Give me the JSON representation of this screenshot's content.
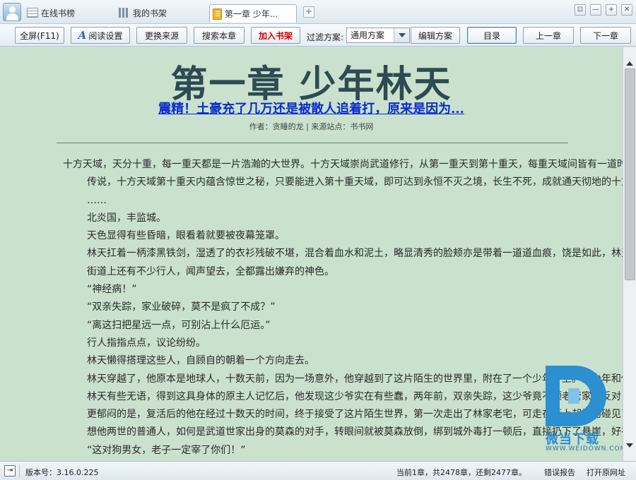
{
  "tabs": {
    "online": "在线书榜",
    "shelf": "我的书架",
    "active": "第一章 少年..."
  },
  "window": {
    "add_tab": "+",
    "restore": "⊡",
    "minimize": "—",
    "maximize": "+",
    "close": "✕"
  },
  "toolbar": {
    "fullscreen": "全屏(F11)",
    "reading_settings": "阅读设置",
    "change_source": "更换来源",
    "search_book": "搜索本章",
    "add_to_shelf": "加入书架",
    "filter_label": "过滤方案:",
    "filter_value": "通用方案",
    "edit_scheme": "编辑方案",
    "toc": "目录",
    "prev_chapter": "上一章",
    "next_chapter": "下一章"
  },
  "reader": {
    "chapter_title": "第一章 少年林天",
    "headline_link": "震精！土豪充了几万还是被散人追着打，原来是因为...",
    "meta": "作者：贪睡的龙 | 来源站点：书书网",
    "paragraphs": [
      "十方天域，天分十重，每一重天都是一片浩瀚的大世界。十方天域崇尚武道修行，从第一重天到第十重天，每重天域间皆有一道时",
      "传说，十方天域第十重天内蕴含惊世之秘，只要能进入第十重天域，即可达到永恒不灭之境，长生不死，成就通天彻地的十方",
      "……",
      "北炎国，丰监城。",
      "天色显得有些昏暗，眼看着就要被夜幕笼罩。",
      "林天扛着一柄漆黑铁剑，湿透了的衣衫残破不堪，混合着血水和泥土，略显清秀的脸颊亦是带着一道道血痕，饶是如此，林天",
      "街道上还有不少行人，闻声望去，全都露出嫌弃的神色。",
      "“神经病！”",
      "“双亲失踪，家业破碎，莫不是疯了不成？”",
      "“离这扫把星远一点，可别沾上什么厄运。”",
      "行人指指点点，议论纷纷。",
      "林天懒得搭理这些人，自顾自的朝着一个方向走去。",
      "林天穿越了，他原本是地球人，十数天前，因为一场意外，他穿越到了这片陌生的世界里，附在了一个少年身上。这少年和他同",
      "林天有些无语，得到这具身体的原主人记忆后，他发现这少爷实在有些蠢，两年前，双亲失踪，这少爷竟不顾老管家的反对，",
      "更郁闷的是，复活后的他在经过十数天的时间，终于接受了这片陌生世界，第一次走出了林家老宅，可走在街上却恰巧碰见了",
      "想他两世的普通人，如何是武道世家出身的莫森的对手，转眼间就被莫森放倒，绑到城外毒打一顿后，直接扔下了悬崖，好在",
      "“这对狗男女，老子一定宰了你们！”"
    ]
  },
  "statusbar": {
    "version": "版本号：3.16.0.225",
    "progress": "当前1章，共2478章，还剩2477章。",
    "report": "错误报告",
    "open_url": "打开原网址"
  },
  "watermark": {
    "text": "微当下载",
    "sub": "WWW.WEIDOWN.COM"
  },
  "colors": {
    "reader_bg": "#c9e1cd",
    "title": "#2e4a52",
    "link": "#0b2ccf",
    "add_shelf": "#d40000",
    "watermark": "#2b8fd0"
  }
}
